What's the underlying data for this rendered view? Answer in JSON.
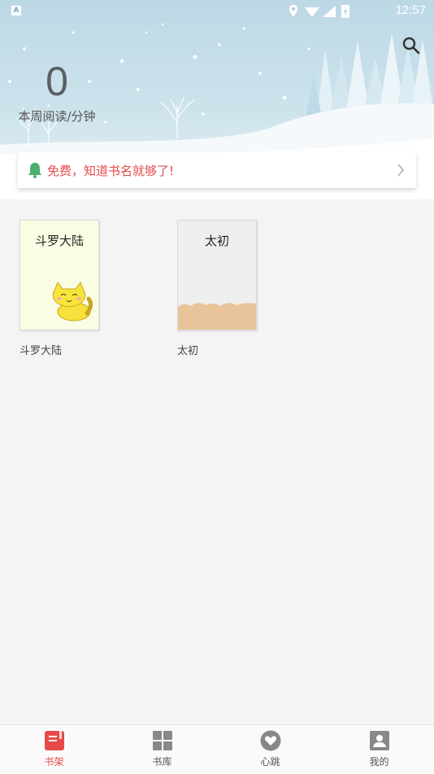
{
  "status_bar": {
    "indicator": "A",
    "time": "12:57"
  },
  "header": {
    "search_icon": "search-icon"
  },
  "reading_stats": {
    "minutes": "0",
    "label": "本周阅读/分钟"
  },
  "notice": {
    "icon": "bell-icon",
    "text": "免费，知道书名就够了!",
    "color": "#e64a4a"
  },
  "bookshelf": {
    "books": [
      {
        "cover_title": "斗罗大陆",
        "name": "斗罗大陆"
      },
      {
        "cover_title": "太初",
        "name": "太初"
      }
    ]
  },
  "tabbar": {
    "accent": "#e64a4a",
    "tabs": [
      {
        "label": "书架",
        "icon": "book-icon",
        "active": true
      },
      {
        "label": "书库",
        "icon": "grid-icon",
        "active": false
      },
      {
        "label": "心跳",
        "icon": "heart-icon",
        "active": false
      },
      {
        "label": "我的",
        "icon": "profile-icon",
        "active": false
      }
    ]
  }
}
